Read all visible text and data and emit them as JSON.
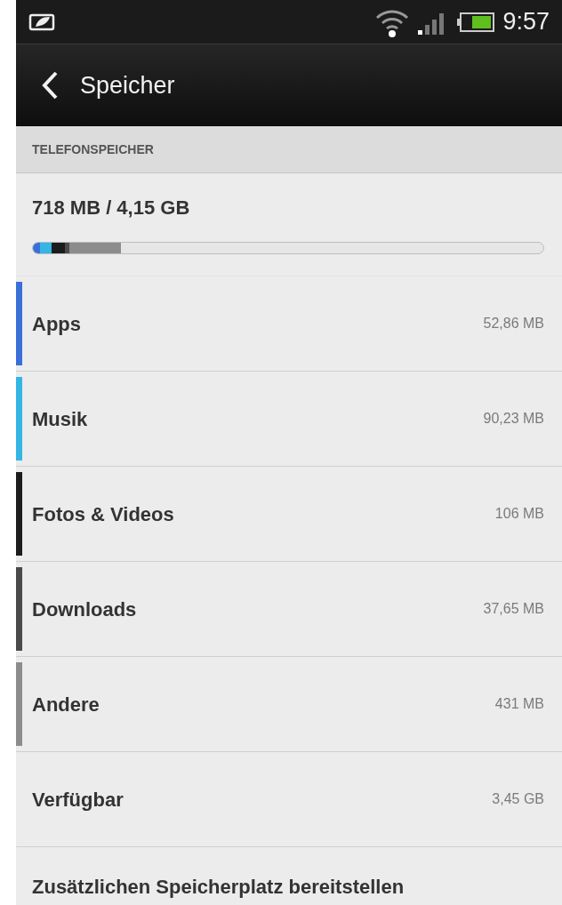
{
  "status_bar": {
    "time": "9:57"
  },
  "action_bar": {
    "title": "Speicher"
  },
  "section": {
    "header": "TELEFONSPEICHER",
    "summary": "718 MB / 4,15 GB"
  },
  "categories": [
    {
      "name": "Apps",
      "size": "52,86 MB",
      "color": "#3a6fd8",
      "level": 0.014
    },
    {
      "name": "Musik",
      "size": "90,23 MB",
      "color": "#33b5e5",
      "level": 0.022
    },
    {
      "name": "Fotos & Videos",
      "size": "106 MB",
      "color": "#1c1c1c",
      "level": 0.026
    },
    {
      "name": "Downloads",
      "size": "37,65 MB",
      "color": "#4a4a4a",
      "level": 0.009
    },
    {
      "name": "Andere",
      "size": "431 MB",
      "color": "#8c8c8c",
      "level": 0.101
    }
  ],
  "available": {
    "name": "Verfügbar",
    "size": "3,45 GB"
  },
  "extra": {
    "title": "Zusätzlichen Speicherplatz bereitstellen"
  }
}
